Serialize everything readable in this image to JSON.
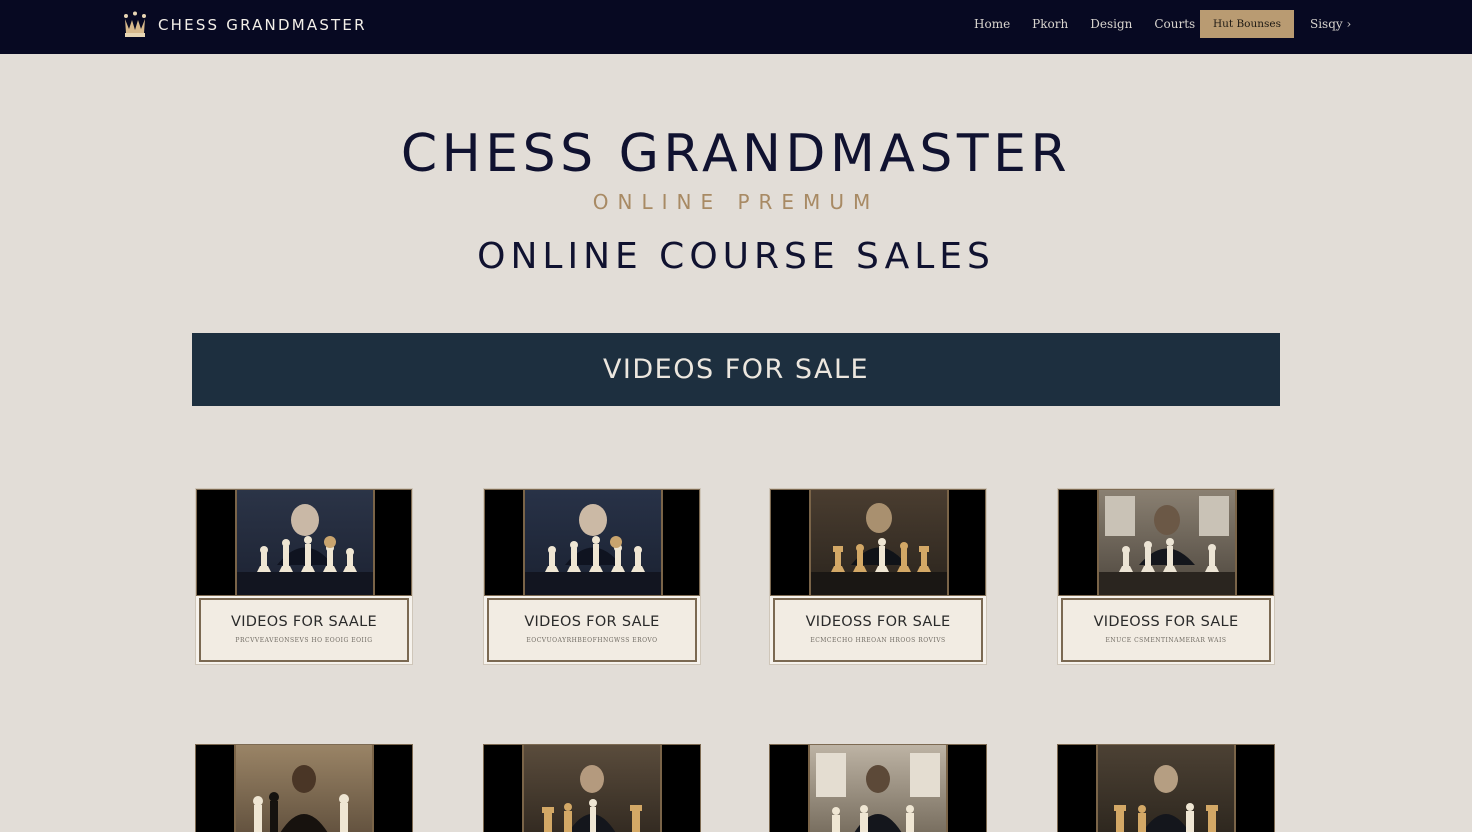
{
  "nav": {
    "brand": "CHESS GRANDMASTER",
    "links": [
      "Home",
      "Pkorh",
      "Design",
      "Courts"
    ],
    "cta": "Hut Bounses",
    "signin": "Sisqy ›"
  },
  "hero": {
    "title": "CHESS GRANDMASTER",
    "subtitle": "ONLINE PREMUM",
    "tagline": "ONLINE COURSE SALES"
  },
  "banner": {
    "label": "VIDEOS FOR SALE"
  },
  "cards": [
    {
      "title": "VIDEOS FOR SAALE",
      "subtitle": "PRCVVEAVEONSEVS HO EOOIG EOIIG"
    },
    {
      "title": "VIDEOS FOR SALE",
      "subtitle": "EOCVUOAYRHBEOFHNGWSS EROVO"
    },
    {
      "title": "VIDEOSS FOR SALE",
      "subtitle": "ECMCECHO HREOAN HROOS ROVIVS"
    },
    {
      "title": "VIDEOSS FOR SALE",
      "subtitle": "ENUCE CSMENTINAMERAR WAIS"
    }
  ],
  "colors": {
    "nav_bg": "#070922",
    "page_bg": "#e2ddd7",
    "banner_bg": "#1d2f3f",
    "accent_gold": "#b99b72",
    "subtitle_gold": "#a88a64"
  },
  "icons": {
    "brand": "crown-icon"
  }
}
